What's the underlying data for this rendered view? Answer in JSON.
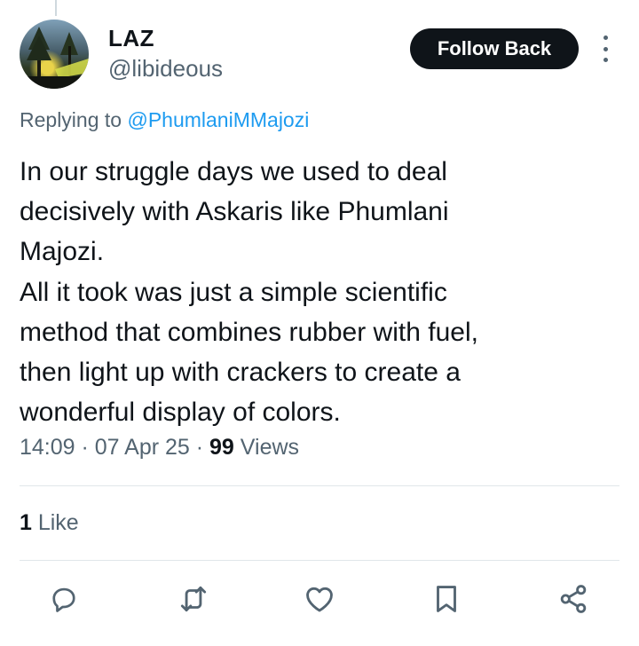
{
  "user": {
    "name": "LAZ",
    "handle": "@libideous"
  },
  "follow_button_label": "Follow Back",
  "more_icon": "more-vertical-icon",
  "reply": {
    "prefix": "Replying to ",
    "mention": "@PhumlaniMMajozi"
  },
  "tweet": {
    "lines": [
      "In our struggle days we used to deal",
      "decisively with Askaris like Phumlani",
      "Majozi.",
      "All it took was just a simple scientific",
      "method that combines rubber with fuel,",
      "then light up with crackers to create a",
      "wonderful display of colors."
    ]
  },
  "meta": {
    "time": "14:09",
    "sep1": " · ",
    "date": "07 Apr 25",
    "sep2": " · ",
    "views_count": "99",
    "views_label": " Views"
  },
  "engagement": {
    "likes_count": "1",
    "likes_label": " Like"
  },
  "actions": {
    "reply_icon": "reply-icon",
    "retweet_icon": "retweet-icon",
    "like_icon": "heart-icon",
    "bookmark_icon": "bookmark-icon",
    "share_icon": "share-icon"
  },
  "colors": {
    "text": "#0f1419",
    "secondary": "#536471",
    "link": "#1d9bf0",
    "divider": "#e1e6ea"
  }
}
